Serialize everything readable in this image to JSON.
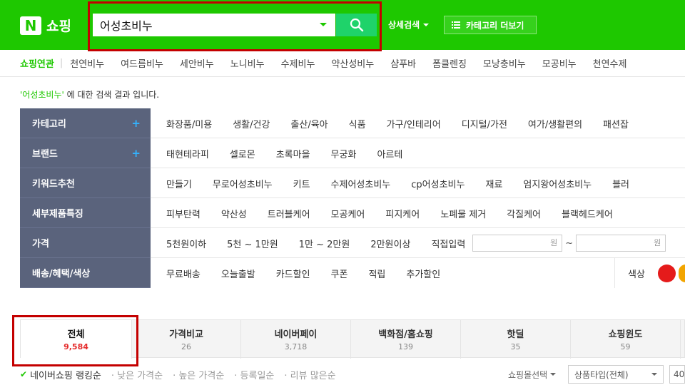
{
  "header": {
    "logo_mark": "N",
    "logo_text": "쇼핑",
    "search_value": "어성초비누",
    "detail_search": "상세검색",
    "category_more": "카테고리 더보기"
  },
  "related": {
    "label": "쇼핑연관",
    "items": [
      "천연비누",
      "여드름비누",
      "세안비누",
      "노니비누",
      "수제비누",
      "약산성비누",
      "샴푸바",
      "폼클렌징",
      "모낭충비누",
      "모공비누",
      "천연수제"
    ]
  },
  "result_message": {
    "query": "'어성초비누'",
    "suffix": " 에 대한 검색 결과 입니다."
  },
  "filters": {
    "category": {
      "label": "카테고리",
      "items": [
        "화장품/미용",
        "생활/건강",
        "출산/육아",
        "식품",
        "가구/인테리어",
        "디지털/가전",
        "여가/생활편의",
        "패션잡"
      ]
    },
    "brand": {
      "label": "브랜드",
      "items": [
        "태현테라피",
        "셀로몬",
        "초록마을",
        "무궁화",
        "아르테"
      ]
    },
    "keyword": {
      "label": "키워드추천",
      "items": [
        "만들기",
        "무로어성초비누",
        "키트",
        "수제어성초비누",
        "cp어성초비누",
        "재료",
        "엄지왕어성초비누",
        "블러"
      ]
    },
    "feature": {
      "label": "세부제품특징",
      "items": [
        "피부탄력",
        "약산성",
        "트러블케어",
        "모공케어",
        "피지케어",
        "노폐물 제거",
        "각질케어",
        "블랙헤드케어"
      ]
    },
    "price": {
      "label": "가격",
      "items": [
        "5천원이하",
        "5천 ~ 1만원",
        "1만 ~ 2만원",
        "2만원이상",
        "직접입력"
      ],
      "won": "원",
      "tilde": "~"
    },
    "delivery": {
      "label": "배송/혜택/색상",
      "items": [
        "무료배송",
        "오늘출발",
        "카드할인",
        "쿠폰",
        "적립",
        "추가할인"
      ],
      "color_label": "색상"
    },
    "plus": "+"
  },
  "tabs": [
    {
      "name": "전체",
      "count": "9,584"
    },
    {
      "name": "가격비교",
      "count": "26"
    },
    {
      "name": "네이버페이",
      "count": "3,718"
    },
    {
      "name": "백화점/홈쇼핑",
      "count": "139"
    },
    {
      "name": "핫딜",
      "count": "35"
    },
    {
      "name": "쇼핑윈도",
      "count": "59"
    }
  ],
  "sort": {
    "check": "✔",
    "active": "네이버쇼핑 랭킹순",
    "options": [
      "· 낮은 가격순",
      "· 높은 가격순",
      "· 등록일순",
      "· 리뷰 많은순"
    ],
    "mall_select": "쇼핑몰선택",
    "product_type": "상품타입(전체)",
    "count_box": "40"
  },
  "colors": {
    "brand_green": "#1ec800",
    "highlight_red": "#c40000",
    "filter_head": "#5a637c"
  }
}
